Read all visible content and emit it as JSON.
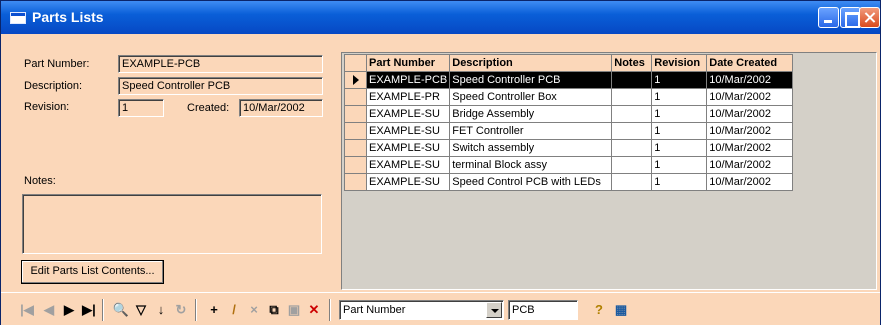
{
  "window": {
    "title": "Parts Lists"
  },
  "form": {
    "part_number_label": "Part Number:",
    "part_number_value": "EXAMPLE-PCB",
    "description_label": "Description:",
    "description_value": "Speed Controller PCB",
    "revision_label": "Revision:",
    "revision_value": "1",
    "created_label": "Created:",
    "created_value": "10/Mar/2002",
    "notes_label": "Notes:",
    "edit_button_label": "Edit Parts List Contents..."
  },
  "grid": {
    "columns": [
      "Part Number",
      "Description",
      "Notes",
      "Revision",
      "Date Created"
    ],
    "rows": [
      {
        "part": "EXAMPLE-PCB",
        "desc": "Speed Controller PCB",
        "notes": "",
        "rev": "1",
        "date": "10/Mar/2002",
        "selected": true
      },
      {
        "part": "EXAMPLE-PR",
        "desc": "Speed Controller Box",
        "notes": "",
        "rev": "1",
        "date": "10/Mar/2002"
      },
      {
        "part": "EXAMPLE-SU",
        "desc": "Bridge Assembly",
        "notes": "",
        "rev": "1",
        "date": "10/Mar/2002"
      },
      {
        "part": "EXAMPLE-SU",
        "desc": "FET Controller",
        "notes": "",
        "rev": "1",
        "date": "10/Mar/2002"
      },
      {
        "part": "EXAMPLE-SU",
        "desc": "Switch assembly",
        "notes": "",
        "rev": "1",
        "date": "10/Mar/2002"
      },
      {
        "part": "EXAMPLE-SU",
        "desc": "terminal Block assy",
        "notes": "",
        "rev": "1",
        "date": "10/Mar/2002"
      },
      {
        "part": "EXAMPLE-SU",
        "desc": "Speed Control PCB with LEDs",
        "notes": "",
        "rev": "1",
        "date": "10/Mar/2002"
      }
    ]
  },
  "toolbar": {
    "search_field_value": "Part Number",
    "search_text_value": "PCB",
    "icons": [
      "first-record-icon",
      "prev-record-icon",
      "next-record-icon",
      "last-record-icon",
      "find-icon",
      "filter-icon",
      "sort-icon",
      "refresh-icon",
      "add-icon",
      "edit-icon",
      "cancel-icon",
      "copy-icon",
      "save-icon",
      "delete-icon",
      "help-icon",
      "table-view-icon"
    ]
  }
}
